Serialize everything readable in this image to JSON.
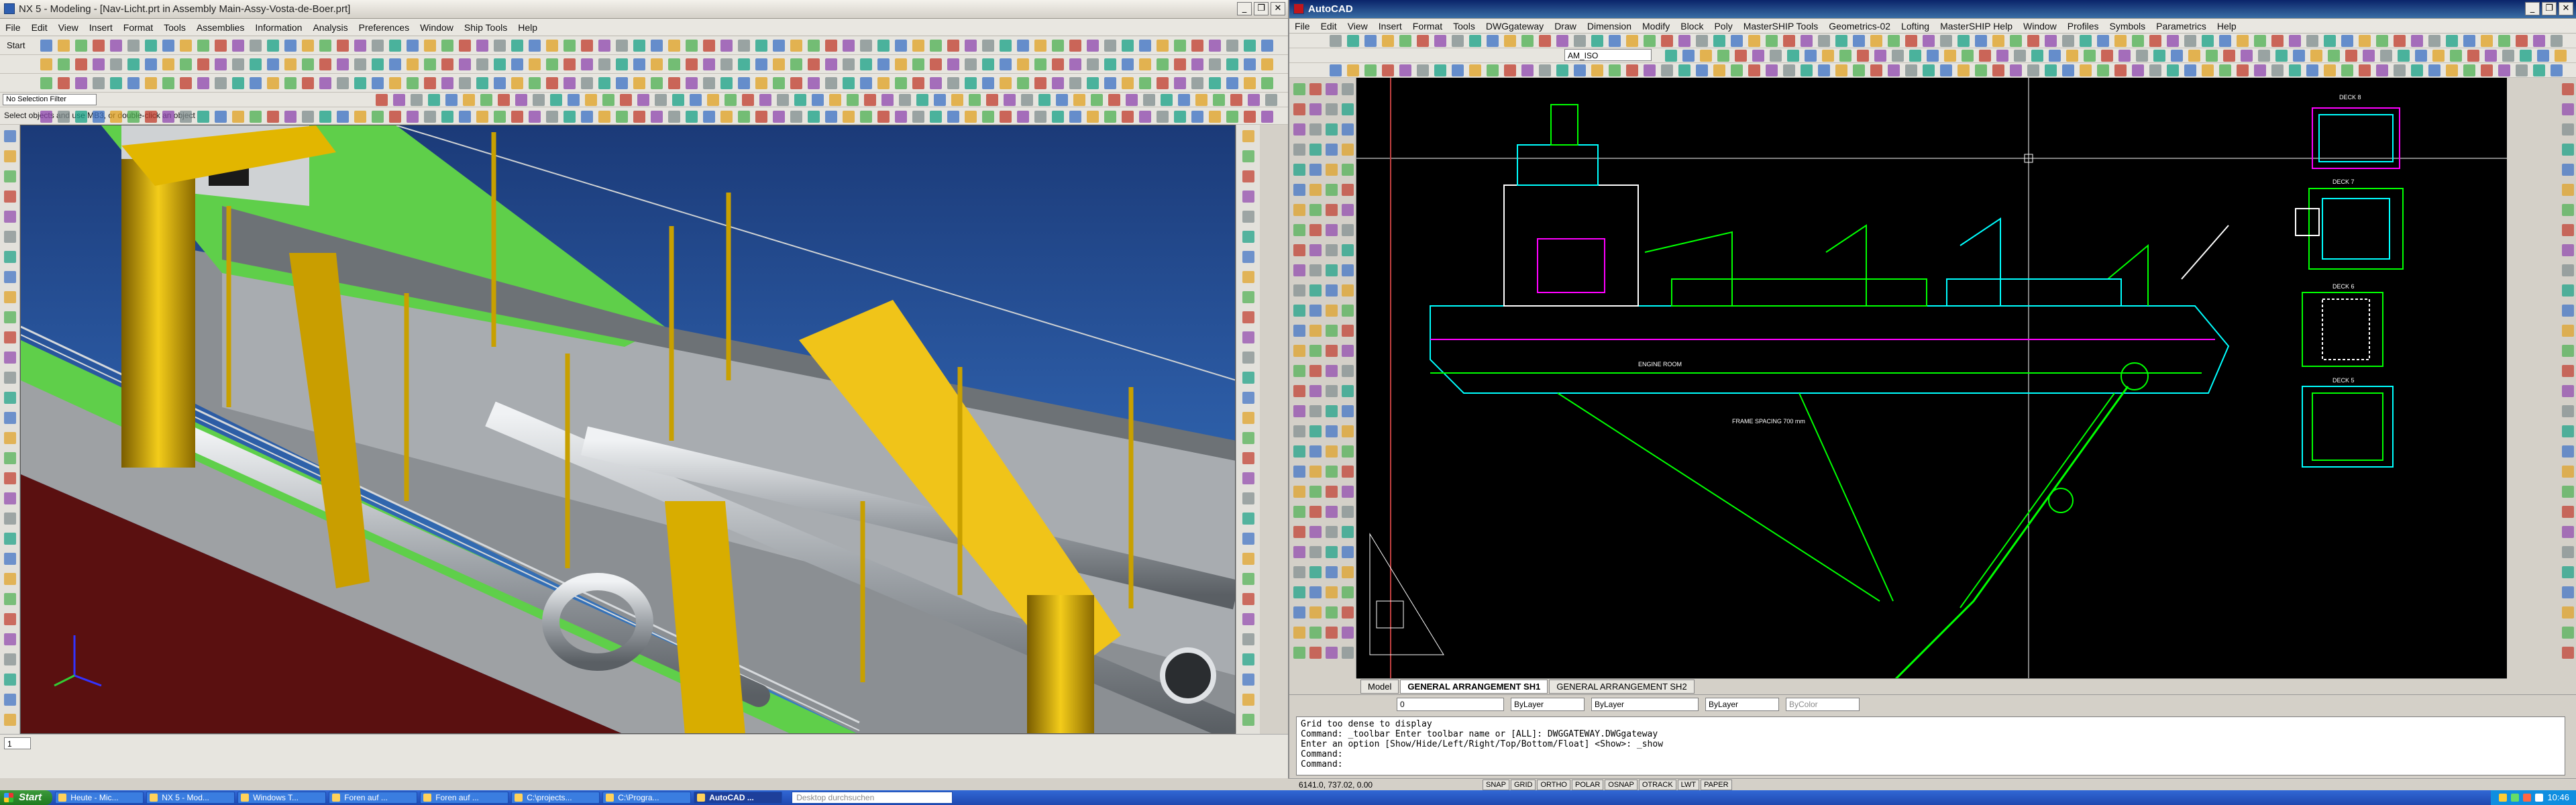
{
  "nx": {
    "title": "NX 5 - Modeling - [Nav-Licht.prt in Assembly Main-Assy-Vosta-de-Boer.prt]",
    "menu": [
      "File",
      "Edit",
      "View",
      "Insert",
      "Format",
      "Tools",
      "Assemblies",
      "Information",
      "Analysis",
      "Preferences",
      "Window",
      "Ship Tools",
      "Help"
    ],
    "start_label": "Start",
    "selection_filter": "No Selection Filter",
    "prompt": "Select objects and use MB3, or double-click an object",
    "layer_value": "1"
  },
  "acad": {
    "title": "AutoCAD",
    "menu": [
      "File",
      "Edit",
      "View",
      "Insert",
      "Format",
      "Tools",
      "DWGgateway",
      "Draw",
      "Dimension",
      "Modify",
      "Block",
      "Poly",
      "MasterSHIP Tools",
      "Geometrics-02",
      "Lofting",
      "MasterSHIP Help",
      "Window",
      "Profiles",
      "Symbols",
      "Parametrics",
      "Help"
    ],
    "dimstyle": "AM_ISO",
    "tabs": [
      "Model",
      "GENERAL ARRANGEMENT SH1",
      "GENERAL ARRANGEMENT SH2"
    ],
    "active_tab": "GENERAL ARRANGEMENT SH1",
    "layer_combo": "0",
    "color_combo": "ByLayer",
    "linetype_combo": "ByLayer",
    "lineweight_combo": "ByLayer",
    "plotstyle_combo": "ByColor",
    "command_lines": [
      "Grid too dense to display",
      "Command: _toolbar Enter toolbar name or [ALL]: DWGGATEWAY.DWGgateway",
      "Enter an option [Show/Hide/Left/Right/Top/Bottom/Float] <Show>: _show",
      "Command:",
      "Command:"
    ],
    "coords": "6141.0, 737.02, 0.00",
    "status_toggles": [
      "SNAP",
      "GRID",
      "ORTHO",
      "POLAR",
      "OSNAP",
      "OTRACK",
      "LWT",
      "PAPER"
    ],
    "drawing_labels": {
      "deck_a": "DECK 8",
      "deck_b": "DECK 7",
      "deck_c": "DECK 6",
      "deck_d": "DECK 5",
      "engine_room": "ENGINE ROOM",
      "frame_spacing": "FRAME SPACING 700 mm"
    }
  },
  "taskbar": {
    "start": "Start",
    "tasks": [
      "Heute - Mic...",
      "NX 5 - Mod...",
      "Windows T...",
      "Foren auf ...",
      "Foren auf ...",
      "C:\\projects...",
      "C:\\Progra...",
      "AutoCAD ..."
    ],
    "active_task": "AutoCAD ...",
    "search_placeholder": "Desktop durchsuchen",
    "clock": "10:46"
  },
  "colors": {
    "cad_green": "#00ff00",
    "cad_cyan": "#00ffff",
    "cad_magenta": "#ff00ff",
    "cad_red": "#ff0000",
    "cad_white": "#ffffff",
    "deck_green": "#5fcf4a",
    "pipe_gray": "#b8bcc0",
    "crane_yellow": "#e2b600"
  }
}
